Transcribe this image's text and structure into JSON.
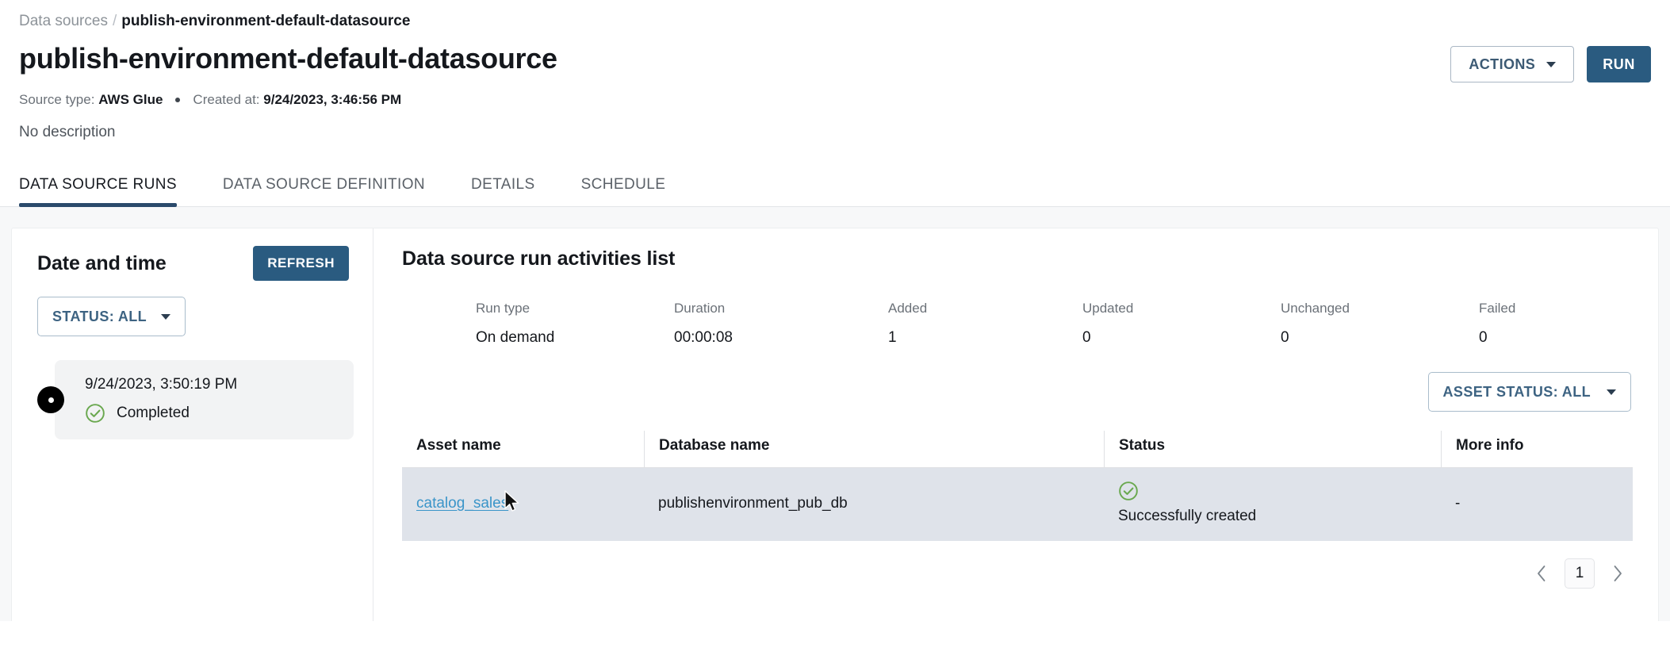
{
  "breadcrumb": {
    "parent": "Data sources",
    "separator": "/",
    "current": "publish-environment-default-datasource"
  },
  "header": {
    "title": "publish-environment-default-datasource",
    "source_type_label": "Source type:",
    "source_type_value": "AWS Glue",
    "created_at_label": "Created at:",
    "created_at_value": "9/24/2023, 3:46:56 PM",
    "description": "No description",
    "actions_button": "ACTIONS",
    "run_button": "RUN"
  },
  "tabs": [
    {
      "label": "DATA SOURCE RUNS",
      "active": true
    },
    {
      "label": "DATA SOURCE DEFINITION",
      "active": false
    },
    {
      "label": "DETAILS",
      "active": false
    },
    {
      "label": "SCHEDULE",
      "active": false
    }
  ],
  "sidebar": {
    "title": "Date and time",
    "refresh_button": "REFRESH",
    "status_filter": "STATUS: ALL",
    "runs": [
      {
        "timestamp": "9/24/2023, 3:50:19 PM",
        "status": "Completed",
        "status_icon": "check-circle-icon",
        "selected": true
      }
    ]
  },
  "main": {
    "title": "Data source run activities list",
    "summary": {
      "labels": [
        "Run type",
        "Duration",
        "Added",
        "Updated",
        "Unchanged",
        "Failed"
      ],
      "values": [
        "On demand",
        "00:00:08",
        "1",
        "0",
        "0",
        "0"
      ]
    },
    "asset_status_filter": "ASSET STATUS: ALL",
    "table": {
      "columns": [
        "Asset name",
        "Database name",
        "Status",
        "More info"
      ],
      "rows": [
        {
          "asset_name": "catalog_sales",
          "database_name": "publishenvironment_pub_db",
          "status_icon": "check-circle-icon",
          "status": "Successfully created",
          "more_info": "-"
        }
      ]
    },
    "pagination": {
      "prev": "‹",
      "page": "1",
      "next": "›"
    }
  },
  "colors": {
    "accent_blue": "#2a5b80",
    "tab_underline": "#2a4a6b",
    "link_blue": "#3b95c9",
    "success_green": "#6aa84f",
    "row_highlight": "#dfe3ea"
  }
}
